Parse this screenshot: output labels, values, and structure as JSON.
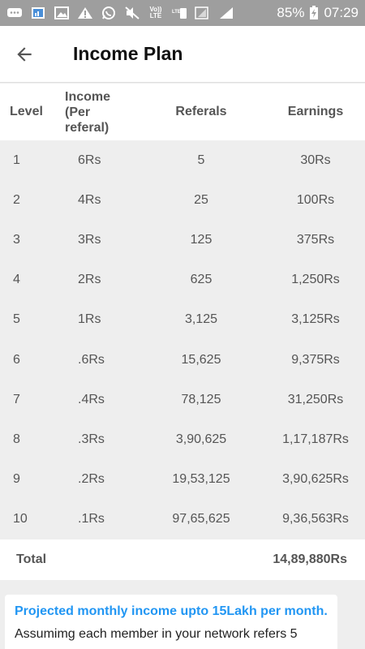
{
  "status_bar": {
    "icons": [
      "chat-icon",
      "image-icon",
      "gallery-icon",
      "warning-icon",
      "whatsapp-icon",
      "mute-icon",
      "volte-icon",
      "lte-signal-icon",
      "signal-icon"
    ],
    "volte_label": "Vo)) LTE",
    "lte_label": "LTE",
    "battery": "85%",
    "time": "07:29"
  },
  "app_bar": {
    "back_icon": "arrow-left-icon",
    "title": "Income Plan"
  },
  "table": {
    "headers": {
      "level": "Level",
      "income": "Income (Per referal)",
      "referals": "Referals",
      "earnings": "Earnings"
    },
    "rows": [
      {
        "level": "1",
        "income": "6Rs",
        "referals": "5",
        "earnings": "30Rs"
      },
      {
        "level": "2",
        "income": "4Rs",
        "referals": "25",
        "earnings": "100Rs"
      },
      {
        "level": "3",
        "income": "3Rs",
        "referals": "125",
        "earnings": "375Rs"
      },
      {
        "level": "4",
        "income": "2Rs",
        "referals": "625",
        "earnings": "1,250Rs"
      },
      {
        "level": "5",
        "income": "1Rs",
        "referals": "3,125",
        "earnings": "3,125Rs"
      },
      {
        "level": "6",
        "income": ".6Rs",
        "referals": "15,625",
        "earnings": "9,375Rs"
      },
      {
        "level": "7",
        "income": ".4Rs",
        "referals": "78,125",
        "earnings": "31,250Rs"
      },
      {
        "level": "8",
        "income": ".3Rs",
        "referals": "3,90,625",
        "earnings": "1,17,187Rs"
      },
      {
        "level": "9",
        "income": ".2Rs",
        "referals": "19,53,125",
        "earnings": "3,90,625Rs"
      },
      {
        "level": "10",
        "income": ".1Rs",
        "referals": "97,65,625",
        "earnings": "9,36,563Rs"
      }
    ],
    "total_label": "Total",
    "total_value": "14,89,880Rs"
  },
  "info_card": {
    "heading": "Projected monthly income upto 15Lakh per month.",
    "text": "Assumimg each member in your network refers 5"
  },
  "colors": {
    "status_bar": "#9e9e9e",
    "accent": "#2196f3",
    "table_body": "#eeeeee"
  }
}
